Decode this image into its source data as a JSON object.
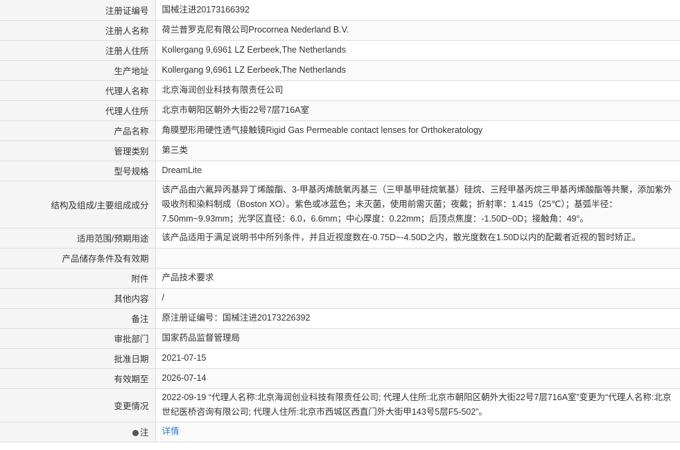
{
  "rows": [
    {
      "label": "注册证编号",
      "value": "国械注进20173166392"
    },
    {
      "label": "注册人名称",
      "value": "荷兰普罗克尼有限公司Procornea Nederland B.V."
    },
    {
      "label": "注册人住所",
      "value": "Kollergang 9,6961 LZ Eerbeek,The Netherlands"
    },
    {
      "label": "生产地址",
      "value": "Kollergang 9,6961 LZ Eerbeek,The Netherlands"
    },
    {
      "label": "代理人名称",
      "value": "北京海润创业科技有限责任公司"
    },
    {
      "label": "代理人住所",
      "value": "北京市朝阳区朝外大街22号7层716A室"
    },
    {
      "label": "产品名称",
      "value": "角膜塑形用硬性透气接触镜Rigid Gas Permeable contact lenses for Orthokeratology"
    },
    {
      "label": "管理类别",
      "value": "第三类"
    },
    {
      "label": "型号规格",
      "value": "DreamLite"
    },
    {
      "label": "结构及组成/主要组成成分",
      "value": "该产品由六氟异丙基异丁烯酸酯、3-甲基丙烯酰氧丙基三（三甲基甲硅烷氧基）硅烷、三羟甲基丙烷三甲基丙烯酸酯等共聚，添加紫外吸收剂和染料制成（Boston XO）。紫色或冰蓝色；未灭菌，使用前需灭菌；夜戴；折射率：1.415（25℃）；基弧半径：7.50mm~9.93mm；光学区直径：6.0，6.6mm；中心厚度：0.22mm；后顶点焦度：-1.50D~0D；接触角：49°。"
    },
    {
      "label": "适用范围/预期用途",
      "value": "该产品适用于满足说明书中所列条件，并且近视度数在-0.75D~-4.50D之内，散光度数在1.50D以内的配戴者近视的暂时矫正。"
    },
    {
      "label": "产品储存条件及有效期",
      "value": ""
    },
    {
      "label": "附件",
      "value": "产品技术要求"
    },
    {
      "label": "其他内容",
      "value": "/"
    },
    {
      "label": "备注",
      "value": "原注册证编号：国械注进20173226392"
    },
    {
      "label": "审批部门",
      "value": "国家药品监督管理局"
    },
    {
      "label": "批准日期",
      "value": "2021-07-15"
    },
    {
      "label": "有效期至",
      "value": "2026-07-14"
    },
    {
      "label": "变更情况",
      "value": "2022-09-19 “代理人名称:北京海润创业科技有限责任公司; 代理人住所:北京市朝阳区朝外大街22号7层716A室”变更为“代理人名称:北京世纪医桥咨询有限公司; 代理人住所:北京市西城区西直门外大街甲143号5层F5-502”。"
    }
  ],
  "note": {
    "icon": "note-icon",
    "label": "注",
    "link_text": "详情"
  },
  "colors": {
    "label_bg": "#f5f5f5",
    "border": "#dddddd",
    "link": "#2e7cd6",
    "text": "#333333"
  }
}
